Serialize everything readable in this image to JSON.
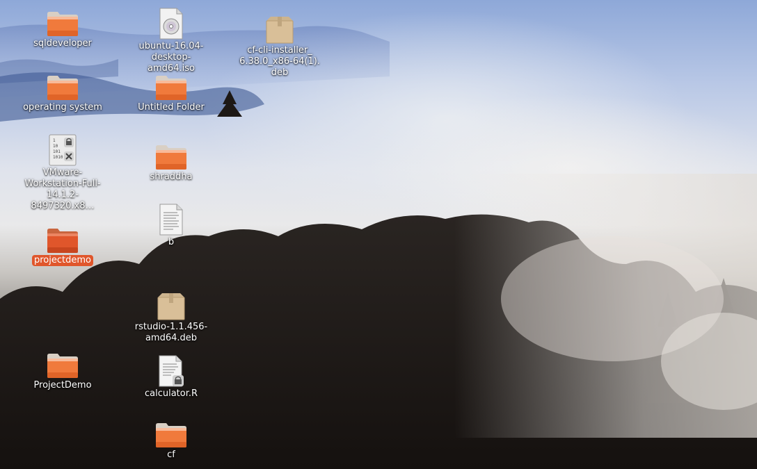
{
  "desktop": {
    "colors": {
      "folder_body": "#f07a3c",
      "folder_tab": "#e06428",
      "selection": "#e0562b",
      "label_text": "#ffffff"
    },
    "icons": [
      {
        "id": "sqldeveloper",
        "label": "sqldeveloper",
        "type": "folder-icon"
      },
      {
        "id": "ubuntu-iso",
        "label": "ubuntu-16.04-\ndesktop-amd64.iso",
        "type": "disc-image-icon"
      },
      {
        "id": "cf-cli-installer",
        "label": "cf-cli-installer_\n6.38.0_x86-64(1).\ndeb",
        "type": "package-icon"
      },
      {
        "id": "operating-system",
        "label": "operating system",
        "type": "folder-icon"
      },
      {
        "id": "untitled-folder",
        "label": "Untitled Folder",
        "type": "folder-icon"
      },
      {
        "id": "vmware",
        "label": "VMware-\nWorkstation-Full-\n14.1.2-8497320.x8…",
        "type": "locked-binary-icon"
      },
      {
        "id": "shraddha",
        "label": "shraddha",
        "type": "folder-icon"
      },
      {
        "id": "b",
        "label": "b",
        "type": "text-file-icon"
      },
      {
        "id": "projectdemo",
        "label": "projectdemo",
        "type": "folder-icon",
        "selected": true
      },
      {
        "id": "rstudio",
        "label": "rstudio-1.1.456-\namd64.deb",
        "type": "package-icon"
      },
      {
        "id": "ProjectDemo2",
        "label": "ProjectDemo",
        "type": "folder-icon"
      },
      {
        "id": "calculator",
        "label": "calculator.R",
        "type": "locked-text-file-icon"
      },
      {
        "id": "cf",
        "label": "cf",
        "type": "folder-icon"
      }
    ]
  }
}
